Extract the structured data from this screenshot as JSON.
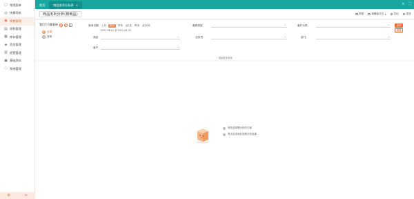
{
  "sidebar": {
    "items": [
      {
        "label": "常用菜单",
        "icon": "chat-icon",
        "active": false
      },
      {
        "label": "快捷导航",
        "icon": "compass-icon",
        "active": false
      },
      {
        "label": "销售管理",
        "icon": "sales-icon",
        "active": true
      },
      {
        "label": "采购管理",
        "icon": "purchase-icon",
        "active": false
      },
      {
        "label": "库存管理",
        "icon": "inventory-icon",
        "active": false
      },
      {
        "label": "资金管理",
        "icon": "money-icon",
        "active": false
      },
      {
        "label": "经营管理",
        "icon": "chart-icon",
        "active": false
      },
      {
        "label": "基础资料",
        "icon": "database-icon",
        "active": false
      },
      {
        "label": "系统管理",
        "icon": "settings-icon",
        "active": false
      }
    ],
    "footer": {
      "left_icon": "settings-icon",
      "right_icon": "logout-icon"
    }
  },
  "tabs": [
    {
      "label": "首页",
      "active": false
    },
    {
      "label": "商品毛利分析表",
      "active": true
    }
  ],
  "page_title": "商品毛利分析(按商品)",
  "toolbar": {
    "help": "帮助",
    "export": "按模板打印",
    "print": "导出",
    "more": "更多"
  },
  "schemes": {
    "title": "我们下方案查询",
    "items": [
      {
        "label": "全部",
        "badge": "全",
        "selected": true
      },
      {
        "label": "按单",
        "badge": "单",
        "selected": false
      }
    ]
  },
  "filters": {
    "date_label": "查询日期",
    "date_chips": [
      "上月",
      "本月",
      "本年",
      "近7天",
      "昨天",
      "近30天"
    ],
    "date_range": "2021-06-01 至 2021-06-30",
    "row1_label2": "客商类型",
    "row1_label3": "客户分类",
    "row2_label1": "商品",
    "row2_label2": "业务员",
    "row2_label3": "部门",
    "row3_label1": "客户",
    "query": "查询",
    "reset": "重置",
    "collapse": "收起更多查询"
  },
  "empty_state": {
    "tips": [
      "请先选择需分析的方案",
      "再点击查询并查看分析结果"
    ]
  },
  "colors": {
    "accent": "#e8662f",
    "topbar": "#17a6a0"
  }
}
